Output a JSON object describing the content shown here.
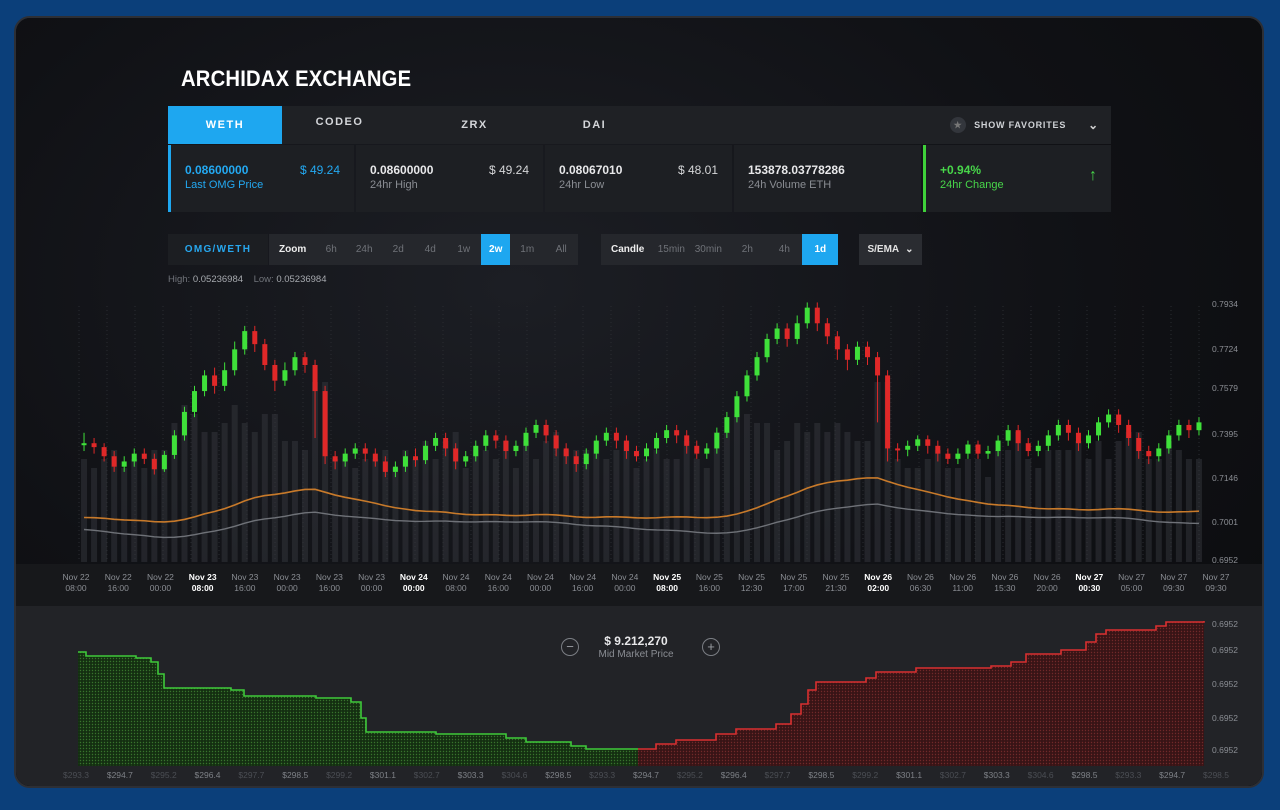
{
  "app": {
    "title": "ARCHIDAX EXCHANGE"
  },
  "tabs": [
    {
      "label": "WETH",
      "active": true
    },
    {
      "label": "CODEO",
      "active": false
    },
    {
      "label": "ZRX",
      "active": false
    },
    {
      "label": "DAI",
      "active": false
    }
  ],
  "favorites": {
    "label": "SHOW FAVORITES"
  },
  "stats": {
    "last_price": {
      "value": "0.08600000",
      "usd": "$ 49.24",
      "label": "Last OMG Price"
    },
    "high": {
      "value": "0.08600000",
      "usd": "$ 49.24",
      "label": "24hr High"
    },
    "low": {
      "value": "0.08067010",
      "usd": "$ 48.01",
      "label": "24hr Low"
    },
    "volume": {
      "value": "153878.03778286",
      "label": "24h Volume ETH"
    },
    "change": {
      "value": "+0.94%",
      "label": "24hr Change"
    }
  },
  "toolbar": {
    "pair": "OMG/WETH",
    "zoom_label": "Zoom",
    "zoom_options": [
      "6h",
      "24h",
      "2d",
      "4d",
      "1w",
      "2w",
      "1m",
      "All"
    ],
    "zoom_selected": "2w",
    "candle_label": "Candle",
    "candle_options": [
      "15min",
      "30min",
      "2h",
      "4h",
      "1d"
    ],
    "candle_selected": "1d",
    "indicator": "S/EMA"
  },
  "hilo": {
    "high_label": "High:",
    "high": "0.05236984",
    "low_label": "Low:",
    "low": "0.05236984"
  },
  "chart_data": [
    {
      "type": "candlestick",
      "y_ticks": [
        "0.7934",
        "0.7724",
        "0.7579",
        "0.7395",
        "0.7146",
        "0.7001",
        "0.6952"
      ],
      "x_ticks": [
        {
          "day": "Nov 22",
          "time": "08:00",
          "bold": false
        },
        {
          "day": "Nov 22",
          "time": "16:00",
          "bold": false
        },
        {
          "day": "Nov 22",
          "time": "00:00",
          "bold": false
        },
        {
          "day": "Nov  23",
          "time": "08:00",
          "bold": true
        },
        {
          "day": "Nov 23",
          "time": "16:00",
          "bold": false
        },
        {
          "day": "Nov 23",
          "time": "00:00",
          "bold": false
        },
        {
          "day": "Nov 23",
          "time": "16:00",
          "bold": false
        },
        {
          "day": "Nov 23",
          "time": "00:00",
          "bold": false
        },
        {
          "day": "Nov 24",
          "time": "00:00",
          "bold": true
        },
        {
          "day": "Nov 24",
          "time": "08:00",
          "bold": false
        },
        {
          "day": "Nov 24",
          "time": "16:00",
          "bold": false
        },
        {
          "day": "Nov 24",
          "time": "00:00",
          "bold": false
        },
        {
          "day": "Nov 24",
          "time": "16:00",
          "bold": false
        },
        {
          "day": "Nov 24",
          "time": "00:00",
          "bold": false
        },
        {
          "day": "Nov 25",
          "time": "08:00",
          "bold": true
        },
        {
          "day": "Nov 25",
          "time": "16:00",
          "bold": false
        },
        {
          "day": "Nov  25",
          "time": "12:30",
          "bold": false
        },
        {
          "day": "Nov 25",
          "time": "17:00",
          "bold": false
        },
        {
          "day": "Nov 25",
          "time": "21:30",
          "bold": false
        },
        {
          "day": "Nov 26",
          "time": "02:00",
          "bold": true
        },
        {
          "day": "Nov 26",
          "time": "06:30",
          "bold": false
        },
        {
          "day": "Nov 26",
          "time": "11:00",
          "bold": false
        },
        {
          "day": "Nov 26",
          "time": "15:30",
          "bold": false
        },
        {
          "day": "Nov 26",
          "time": "20:00",
          "bold": false
        },
        {
          "day": "Nov 27",
          "time": "00:30",
          "bold": true
        },
        {
          "day": "Nov 27",
          "time": "05:00",
          "bold": false
        },
        {
          "day": "Nov 27",
          "time": "09:30",
          "bold": false
        },
        {
          "day": "Nov 27",
          "time": "09:30",
          "bold": false
        }
      ],
      "candles": [
        [
          0.7395,
          0.74,
          0.737,
          0.744
        ],
        [
          0.74,
          0.7385,
          0.736,
          0.742
        ],
        [
          0.7385,
          0.735,
          0.733,
          0.74
        ],
        [
          0.735,
          0.731,
          0.729,
          0.737
        ],
        [
          0.731,
          0.733,
          0.729,
          0.735
        ],
        [
          0.733,
          0.736,
          0.731,
          0.738
        ],
        [
          0.736,
          0.734,
          0.732,
          0.738
        ],
        [
          0.734,
          0.73,
          0.728,
          0.736
        ],
        [
          0.73,
          0.7355,
          0.729,
          0.737
        ],
        [
          0.7355,
          0.743,
          0.734,
          0.745
        ],
        [
          0.743,
          0.752,
          0.741,
          0.754
        ],
        [
          0.752,
          0.76,
          0.75,
          0.762
        ],
        [
          0.76,
          0.766,
          0.758,
          0.768
        ],
        [
          0.766,
          0.762,
          0.759,
          0.769
        ],
        [
          0.762,
          0.768,
          0.76,
          0.771
        ],
        [
          0.768,
          0.776,
          0.766,
          0.779
        ],
        [
          0.776,
          0.783,
          0.774,
          0.785
        ],
        [
          0.783,
          0.778,
          0.775,
          0.785
        ],
        [
          0.778,
          0.77,
          0.768,
          0.78
        ],
        [
          0.77,
          0.764,
          0.76,
          0.772
        ],
        [
          0.764,
          0.768,
          0.762,
          0.771
        ],
        [
          0.768,
          0.773,
          0.766,
          0.775
        ],
        [
          0.773,
          0.77,
          0.767,
          0.775
        ],
        [
          0.77,
          0.76,
          0.742,
          0.772
        ],
        [
          0.76,
          0.735,
          0.732,
          0.762
        ],
        [
          0.735,
          0.733,
          0.73,
          0.737
        ],
        [
          0.733,
          0.736,
          0.731,
          0.738
        ],
        [
          0.736,
          0.738,
          0.734,
          0.74
        ],
        [
          0.738,
          0.736,
          0.733,
          0.74
        ],
        [
          0.736,
          0.733,
          0.731,
          0.738
        ],
        [
          0.733,
          0.729,
          0.727,
          0.735
        ],
        [
          0.729,
          0.731,
          0.727,
          0.733
        ],
        [
          0.731,
          0.735,
          0.729,
          0.737
        ],
        [
          0.735,
          0.7335,
          0.731,
          0.738
        ],
        [
          0.7335,
          0.739,
          0.732,
          0.741
        ],
        [
          0.739,
          0.742,
          0.737,
          0.744
        ],
        [
          0.742,
          0.738,
          0.735,
          0.744
        ],
        [
          0.738,
          0.733,
          0.73,
          0.74
        ],
        [
          0.733,
          0.735,
          0.731,
          0.737
        ],
        [
          0.735,
          0.739,
          0.733,
          0.741
        ],
        [
          0.739,
          0.743,
          0.737,
          0.745
        ],
        [
          0.743,
          0.741,
          0.738,
          0.745
        ],
        [
          0.741,
          0.737,
          0.734,
          0.743
        ],
        [
          0.737,
          0.739,
          0.735,
          0.741
        ],
        [
          0.739,
          0.744,
          0.737,
          0.746
        ],
        [
          0.744,
          0.747,
          0.742,
          0.749
        ],
        [
          0.747,
          0.743,
          0.74,
          0.749
        ],
        [
          0.743,
          0.738,
          0.735,
          0.745
        ],
        [
          0.738,
          0.735,
          0.732,
          0.74
        ],
        [
          0.735,
          0.732,
          0.729,
          0.737
        ],
        [
          0.732,
          0.736,
          0.73,
          0.738
        ],
        [
          0.736,
          0.741,
          0.734,
          0.743
        ],
        [
          0.741,
          0.744,
          0.739,
          0.746
        ],
        [
          0.744,
          0.741,
          0.738,
          0.746
        ],
        [
          0.741,
          0.737,
          0.734,
          0.743
        ],
        [
          0.737,
          0.735,
          0.733,
          0.739
        ],
        [
          0.735,
          0.738,
          0.733,
          0.74
        ],
        [
          0.738,
          0.742,
          0.736,
          0.744
        ],
        [
          0.742,
          0.745,
          0.74,
          0.747
        ],
        [
          0.745,
          0.743,
          0.74,
          0.747
        ],
        [
          0.743,
          0.739,
          0.736,
          0.745
        ],
        [
          0.739,
          0.736,
          0.734,
          0.741
        ],
        [
          0.736,
          0.738,
          0.734,
          0.74
        ],
        [
          0.738,
          0.744,
          0.736,
          0.746
        ],
        [
          0.744,
          0.75,
          0.742,
          0.752
        ],
        [
          0.75,
          0.758,
          0.748,
          0.76
        ],
        [
          0.758,
          0.766,
          0.756,
          0.768
        ],
        [
          0.766,
          0.773,
          0.764,
          0.775
        ],
        [
          0.773,
          0.78,
          0.771,
          0.782
        ],
        [
          0.78,
          0.784,
          0.778,
          0.786
        ],
        [
          0.784,
          0.78,
          0.777,
          0.786
        ],
        [
          0.78,
          0.786,
          0.778,
          0.789
        ],
        [
          0.786,
          0.792,
          0.784,
          0.794
        ],
        [
          0.792,
          0.786,
          0.783,
          0.794
        ],
        [
          0.786,
          0.781,
          0.778,
          0.788
        ],
        [
          0.781,
          0.776,
          0.772,
          0.783
        ],
        [
          0.776,
          0.772,
          0.768,
          0.778
        ],
        [
          0.772,
          0.777,
          0.77,
          0.779
        ],
        [
          0.777,
          0.773,
          0.77,
          0.779
        ],
        [
          0.773,
          0.766,
          0.748,
          0.775
        ],
        [
          0.766,
          0.738,
          0.733,
          0.768
        ],
        [
          0.738,
          0.7375,
          0.733,
          0.74
        ],
        [
          0.7375,
          0.739,
          0.735,
          0.741
        ],
        [
          0.739,
          0.7415,
          0.737,
          0.743
        ],
        [
          0.7415,
          0.739,
          0.736,
          0.743
        ],
        [
          0.739,
          0.736,
          0.733,
          0.741
        ],
        [
          0.736,
          0.734,
          0.732,
          0.738
        ],
        [
          0.734,
          0.736,
          0.732,
          0.738
        ],
        [
          0.736,
          0.7395,
          0.734,
          0.741
        ],
        [
          0.7395,
          0.736,
          0.734,
          0.741
        ],
        [
          0.736,
          0.737,
          0.734,
          0.739
        ],
        [
          0.737,
          0.741,
          0.735,
          0.743
        ],
        [
          0.741,
          0.745,
          0.739,
          0.747
        ],
        [
          0.745,
          0.74,
          0.737,
          0.747
        ],
        [
          0.74,
          0.737,
          0.735,
          0.742
        ],
        [
          0.737,
          0.739,
          0.735,
          0.741
        ],
        [
          0.739,
          0.743,
          0.737,
          0.745
        ],
        [
          0.743,
          0.747,
          0.741,
          0.749
        ],
        [
          0.747,
          0.744,
          0.741,
          0.749
        ],
        [
          0.744,
          0.74,
          0.737,
          0.746
        ],
        [
          0.74,
          0.743,
          0.738,
          0.745
        ],
        [
          0.743,
          0.748,
          0.741,
          0.75
        ],
        [
          0.748,
          0.751,
          0.746,
          0.753
        ],
        [
          0.751,
          0.747,
          0.744,
          0.753
        ],
        [
          0.747,
          0.742,
          0.739,
          0.749
        ],
        [
          0.742,
          0.737,
          0.734,
          0.744
        ],
        [
          0.737,
          0.735,
          0.732,
          0.739
        ],
        [
          0.735,
          0.738,
          0.733,
          0.74
        ],
        [
          0.738,
          0.743,
          0.736,
          0.745
        ],
        [
          0.743,
          0.747,
          0.741,
          0.749
        ],
        [
          0.747,
          0.745,
          0.742,
          0.749
        ],
        [
          0.745,
          0.748,
          0.743,
          0.75
        ]
      ]
    },
    {
      "type": "area",
      "series": [
        {
          "side": "bids",
          "color": "#3fc93a"
        },
        {
          "side": "asks",
          "color": "#d93030"
        }
      ],
      "y_ticks": [
        "0.6952",
        "0.6952",
        "0.6952",
        "0.6952",
        "0.6952"
      ],
      "x_ticks": [
        "$293.3",
        "$294.7",
        "$295.2",
        "$296.4",
        "$297.7",
        "$298.5",
        "$299.2",
        "$301.1",
        "$302.7",
        "$303.3",
        "$304.6",
        "$298.5",
        "$293.3",
        "$294.7",
        "$295.2",
        "$296.4",
        "$297.7",
        "$298.5",
        "$299.2",
        "$301.1",
        "$302.7",
        "$303.3",
        "$304.6",
        "$298.5",
        "$293.3",
        "$294.7",
        "$298.5"
      ],
      "mid_price": "$ 9.212,270",
      "mid_label": "Mid Market Price"
    }
  ],
  "colors": {
    "accent": "#1ea7f0",
    "up": "#3fe03a",
    "down": "#e02828",
    "ema_orange": "#c87a2a",
    "sma_gray": "#6f7278"
  }
}
